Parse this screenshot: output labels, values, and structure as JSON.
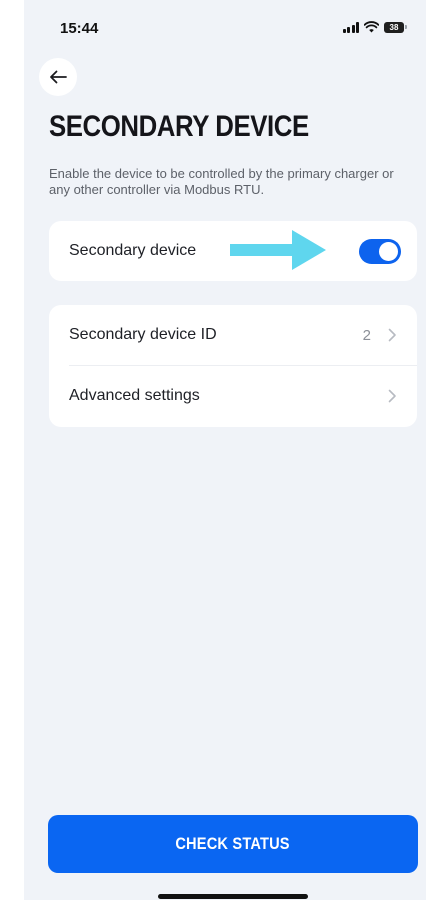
{
  "status_bar": {
    "time": "15:44",
    "battery_level": "38",
    "signal_icon": "cellular-signal-icon",
    "wifi_icon": "wifi-icon"
  },
  "header": {
    "back_icon": "arrow-left-icon",
    "title": "SECONDARY DEVICE",
    "description": "Enable the device to be controlled by the primary charger or any other controller via Modbus RTU."
  },
  "toggle_card": {
    "label": "Secondary device",
    "enabled": true,
    "annotation_arrow_color": "#5fd6ee"
  },
  "settings_card": {
    "items": [
      {
        "label": "Secondary device ID",
        "value": "2"
      },
      {
        "label": "Advanced settings",
        "value": ""
      }
    ]
  },
  "footer": {
    "button_label": "CHECK STATUS"
  },
  "colors": {
    "accent": "#0a66f2",
    "background": "#f0f3f8",
    "card": "#ffffff"
  }
}
